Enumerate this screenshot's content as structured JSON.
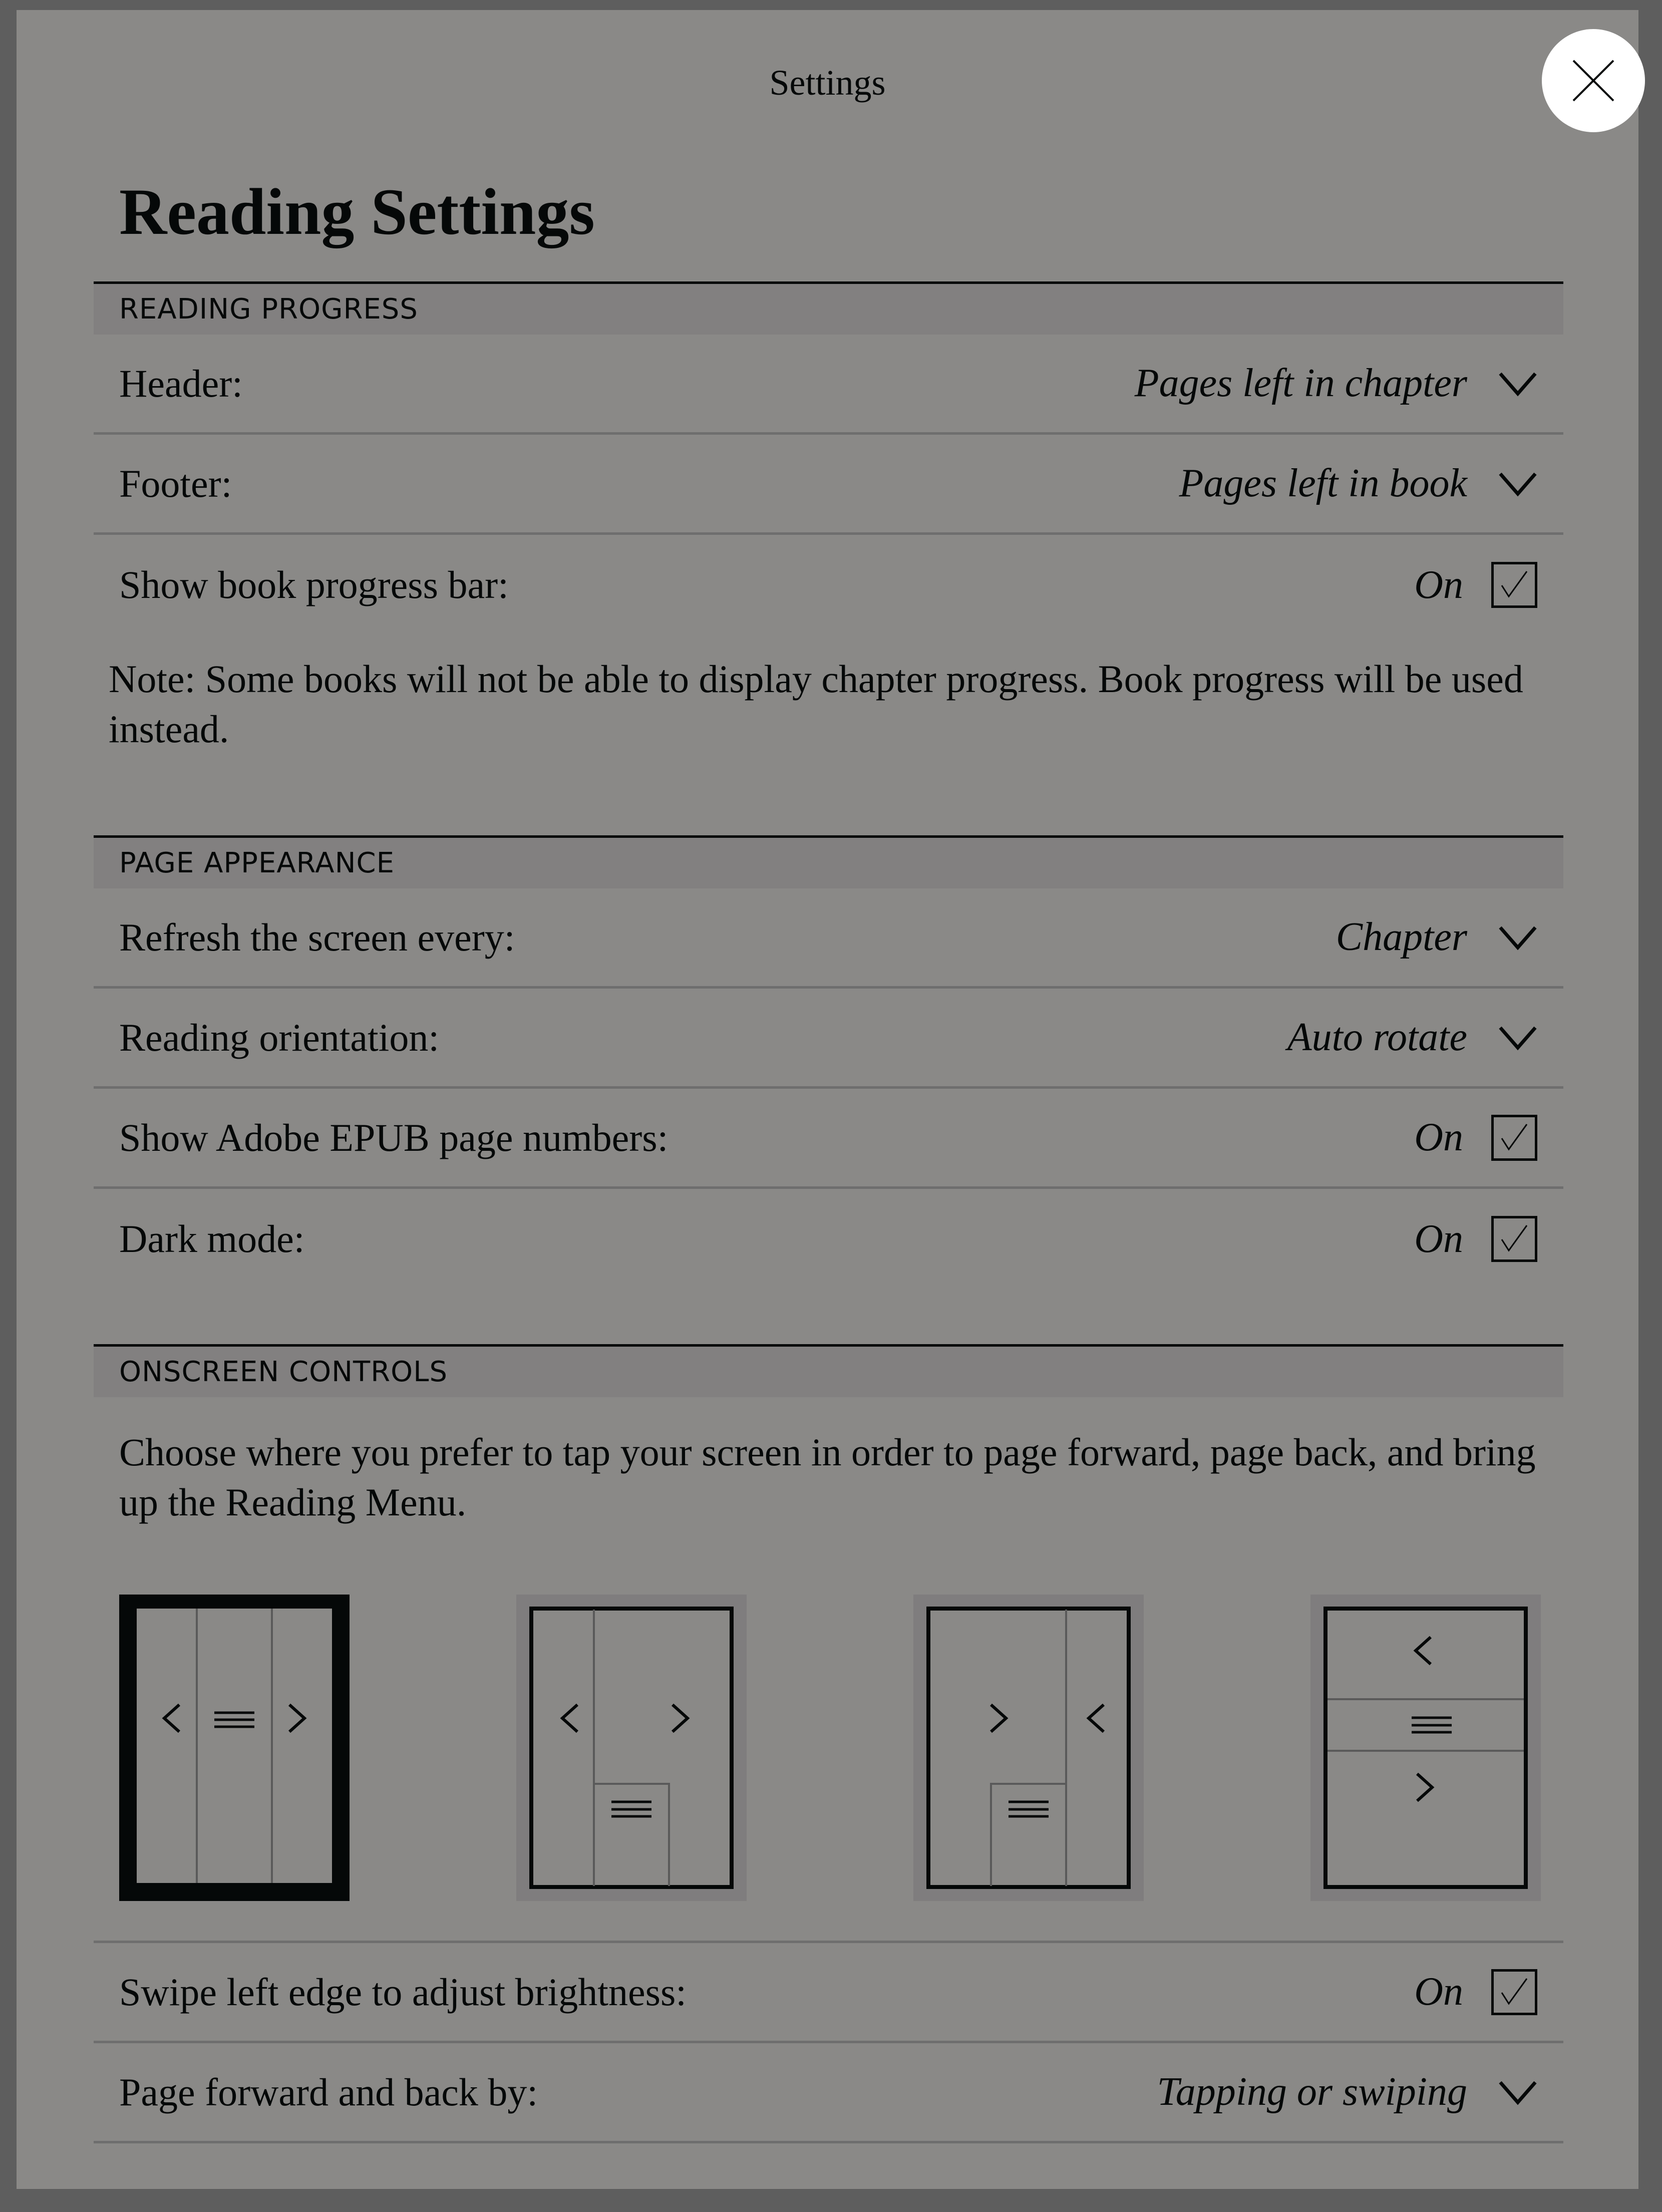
{
  "modal": {
    "title": "Settings",
    "close_icon": "close-icon"
  },
  "page_title": "Reading Settings",
  "colors": {
    "backdrop": "#5e5e5e",
    "panel": "#8a8987",
    "section_header": "#828080",
    "text": "#050808",
    "close_button": "#ffffff"
  },
  "sections": {
    "reading_progress": {
      "header": "READING PROGRESS",
      "rows": [
        {
          "label": "Header:",
          "value": "Pages left in chapter",
          "type": "dropdown"
        },
        {
          "label": "Footer:",
          "value": "Pages left in book",
          "type": "dropdown"
        },
        {
          "label": "Show book progress bar:",
          "value": "On",
          "type": "checkbox",
          "checked": true
        }
      ],
      "note": "Note: Some books will not be able to display chapter progress. Book progress will be used instead."
    },
    "page_appearance": {
      "header": "PAGE APPEARANCE",
      "rows": [
        {
          "label": "Refresh the screen every:",
          "value": "Chapter",
          "type": "dropdown"
        },
        {
          "label": "Reading orientation:",
          "value": "Auto rotate",
          "type": "dropdown"
        },
        {
          "label": "Show Adobe EPUB page numbers:",
          "value": "On",
          "type": "checkbox",
          "checked": true
        },
        {
          "label": "Dark mode:",
          "value": "On",
          "type": "checkbox",
          "checked": true
        }
      ]
    },
    "onscreen_controls": {
      "header": "ONSCREEN CONTROLS",
      "description": "Choose where you prefer to tap your screen in order to page forward, page back, and bring up the Reading Menu.",
      "layouts": [
        {
          "id": "three-columns",
          "selected": true,
          "zones": [
            "back",
            "menu",
            "forward"
          ]
        },
        {
          "id": "left-back-right-forward-bottom-menu",
          "selected": false,
          "zones": [
            "back",
            "forward",
            "menu"
          ]
        },
        {
          "id": "left-forward-right-back-bottom-menu",
          "selected": false,
          "zones": [
            "forward",
            "back",
            "menu"
          ]
        },
        {
          "id": "three-rows",
          "selected": false,
          "zones": [
            "back",
            "menu",
            "forward"
          ]
        }
      ],
      "rows": [
        {
          "label": "Swipe left edge to adjust brightness:",
          "value": "On",
          "type": "checkbox",
          "checked": true
        },
        {
          "label": "Page forward and back by:",
          "value": "Tapping or swiping",
          "type": "dropdown"
        }
      ]
    }
  }
}
